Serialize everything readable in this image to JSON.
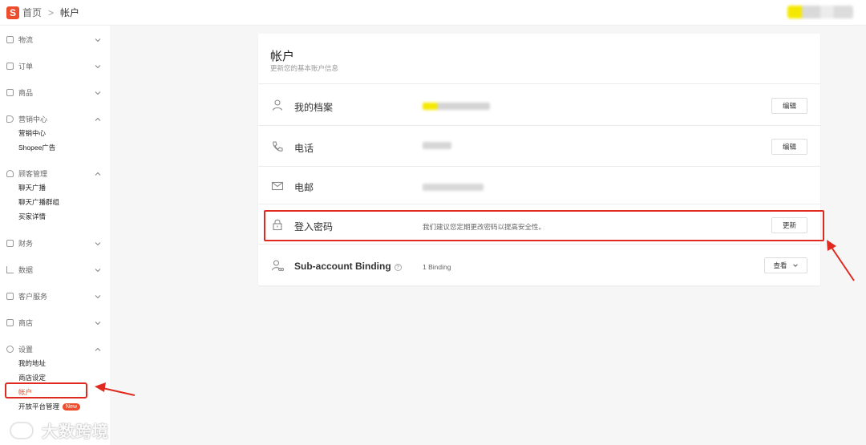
{
  "header": {
    "logo_letter": "S",
    "breadcrumb_home": "首页",
    "breadcrumb_sep": ">",
    "breadcrumb_current": "帐户"
  },
  "sidebar": {
    "groups": [
      {
        "label": "物流",
        "icon": "truck-icon",
        "expanded": false
      },
      {
        "label": "订单",
        "icon": "clipboard-icon",
        "expanded": false
      },
      {
        "label": "商品",
        "icon": "box-icon",
        "expanded": false
      },
      {
        "label": "营销中心",
        "icon": "tag-icon",
        "expanded": true,
        "items": [
          "营销中心",
          "Shopee广告"
        ]
      },
      {
        "label": "顾客管理",
        "icon": "user-icon",
        "expanded": true,
        "items": [
          "聊天广播",
          "聊天广播群组",
          "买家详情"
        ]
      },
      {
        "label": "财务",
        "icon": "wallet-icon",
        "expanded": false
      },
      {
        "label": "数据",
        "icon": "chart-icon",
        "expanded": false
      },
      {
        "label": "客户服务",
        "icon": "chat-icon",
        "expanded": false
      },
      {
        "label": "商店",
        "icon": "shop-icon",
        "expanded": false
      },
      {
        "label": "设置",
        "icon": "gear-icon",
        "expanded": true,
        "items": [
          "我的地址",
          "商店设定",
          "帐户",
          "开放平台管理"
        ]
      }
    ],
    "new_badge": "New"
  },
  "watermark": "大数跨境",
  "account": {
    "title": "帐户",
    "subtitle": "更新您的基本账户信息",
    "rows": {
      "profile": {
        "label": "我的档案",
        "button": "编辑"
      },
      "phone": {
        "label": "电话",
        "button": "编辑"
      },
      "email": {
        "label": "电邮"
      },
      "password": {
        "label": "登入密码",
        "hint": "我们建议您定期更改密码以提高安全性。",
        "button": "更新"
      },
      "subaccount": {
        "label": "Sub-account Binding",
        "value": "1 Binding",
        "button": "查看"
      }
    }
  },
  "colors": {
    "accent": "#ee4d2d",
    "highlight_box": "#e02a20"
  }
}
